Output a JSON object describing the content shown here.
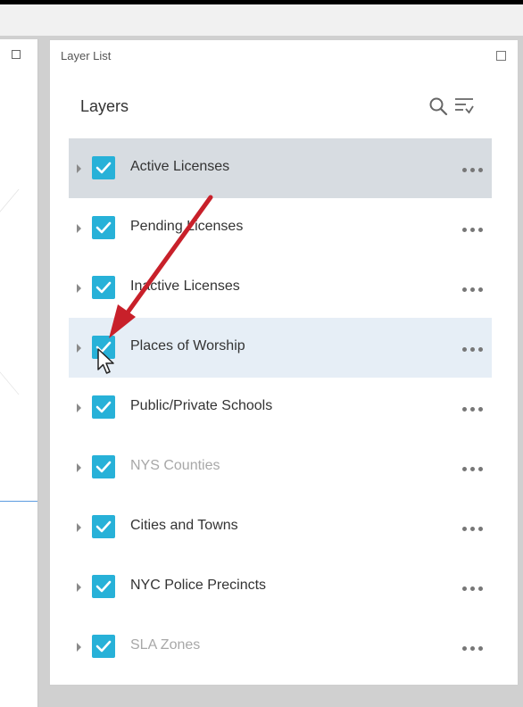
{
  "panel": {
    "title": "Layer List",
    "heading": "Layers"
  },
  "layers": [
    {
      "label": "Active Licenses",
      "checked": true,
      "dim": false,
      "state": "selected"
    },
    {
      "label": "Pending Licenses",
      "checked": true,
      "dim": false,
      "state": ""
    },
    {
      "label": "Inactive Licenses",
      "checked": true,
      "dim": false,
      "state": ""
    },
    {
      "label": "Places of Worship",
      "checked": true,
      "dim": false,
      "state": "hover"
    },
    {
      "label": "Public/Private Schools",
      "checked": true,
      "dim": false,
      "state": ""
    },
    {
      "label": "NYS Counties",
      "checked": true,
      "dim": true,
      "state": ""
    },
    {
      "label": "Cities and Towns",
      "checked": true,
      "dim": false,
      "state": ""
    },
    {
      "label": "NYC Police Precincts",
      "checked": true,
      "dim": false,
      "state": ""
    },
    {
      "label": "SLA Zones",
      "checked": true,
      "dim": true,
      "state": ""
    }
  ],
  "icons": {
    "search": "search-icon",
    "filter": "filter-icon",
    "more": "more-options-icon",
    "checkbox": "checkbox-checked-icon",
    "caret": "expand-caret-icon",
    "maximize": "maximize-icon",
    "annotation_arrow": "red-arrow",
    "cursor": "mouse-cursor"
  },
  "colors": {
    "checkbox": "#27b1d8",
    "selected_row": "#d7dce1",
    "hover_row": "#e6eef6",
    "annotation": "#c8202a"
  }
}
